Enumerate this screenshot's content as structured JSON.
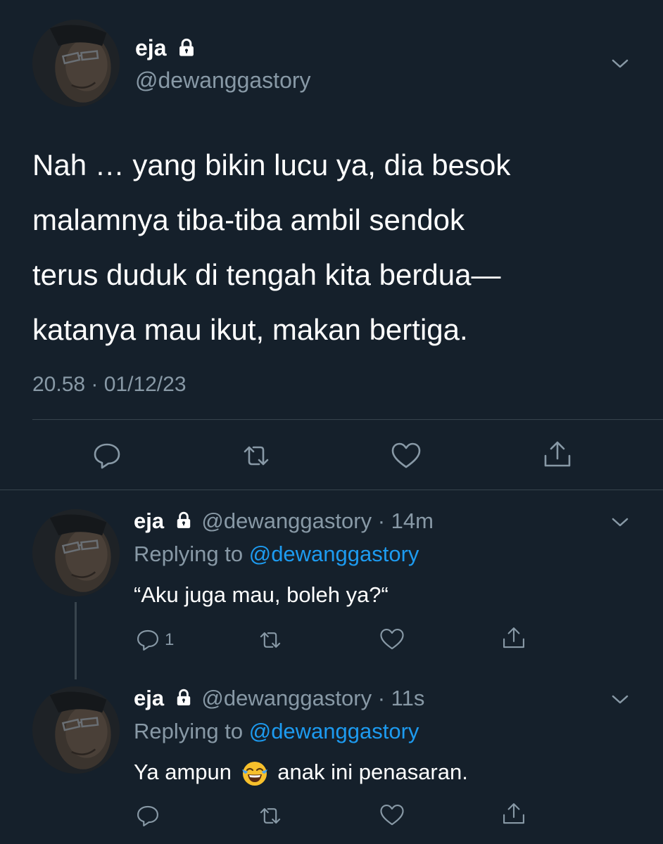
{
  "main_tweet": {
    "author_name": "eja",
    "handle": "@dewanggastory",
    "text_lines": [
      "Nah … yang bikin lucu ya, dia besok",
      "malamnya tiba-tiba ambil sendok",
      "terus duduk di tengah kita berdua—",
      "katanya mau ikut, makan bertiga."
    ],
    "timestamp": "20.58 · 01/12/23",
    "icons": [
      "reply-icon",
      "retweet-icon",
      "like-icon",
      "share-icon"
    ]
  },
  "replies": [
    {
      "author_name": "eja",
      "handle": "@dewanggastory",
      "time": "· 14m",
      "replying_prefix": "Replying to",
      "replying_to": "@dewanggastory",
      "text": "“Aku juga mau, boleh ya?“",
      "reply_count": "1"
    },
    {
      "author_name": "eja",
      "handle": "@dewanggastory",
      "time": "· 11s",
      "replying_prefix": "Replying to",
      "replying_to": "@dewanggastory",
      "text_before_emoji": "Ya ampun",
      "emoji": "face-with-tears-of-joy",
      "text_after_emoji": "anak ini penasaran.",
      "reply_count": ""
    }
  ],
  "colors": {
    "background": "#15202b",
    "muted": "#8899a6",
    "link": "#1d9bf0",
    "divider": "#38444d"
  }
}
